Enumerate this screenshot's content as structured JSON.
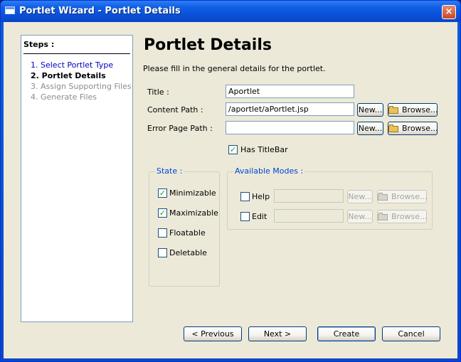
{
  "window": {
    "title": "Portlet Wizard - Portlet Details",
    "close_glyph": "×"
  },
  "steps": {
    "title": "Steps :",
    "items": [
      {
        "label": "1. Select Portlet Type",
        "state": "done"
      },
      {
        "label": "2. Portlet Details",
        "state": "current"
      },
      {
        "label": "3. Assign Supporting Files",
        "state": "future"
      },
      {
        "label": "4. Generate Files",
        "state": "future"
      }
    ]
  },
  "main": {
    "heading": "Portlet Details",
    "description": "Please fill in the general details for the portlet."
  },
  "form": {
    "title_label": "Title :",
    "title_value": "Aportlet",
    "content_path_label": "Content Path :",
    "content_path_value": "/aportlet/aPortlet.jsp",
    "error_page_path_label": "Error Page Path :",
    "error_page_path_value": "",
    "new_label": "New...",
    "browse_label": "Browse...",
    "has_titlebar_label": "Has TitleBar",
    "has_titlebar_checked": true,
    "check_glyph": "✓"
  },
  "state_group": {
    "title": "State :",
    "options": [
      {
        "label": "Minimizable",
        "checked": true
      },
      {
        "label": "Maximizable",
        "checked": true
      },
      {
        "label": "Floatable",
        "checked": false
      },
      {
        "label": "Deletable",
        "checked": false
      }
    ]
  },
  "modes_group": {
    "title": "Available Modes :",
    "modes": [
      {
        "label": "Help",
        "checked": false,
        "value": ""
      },
      {
        "label": "Edit",
        "checked": false,
        "value": ""
      }
    ]
  },
  "footer": {
    "previous": "< Previous",
    "next": "Next >",
    "create": "Create",
    "cancel": "Cancel"
  },
  "colors": {
    "titlebar": "#0a4fd6",
    "window_bg": "#ece9d8",
    "step_done": "#0000c0",
    "step_future": "#8c8c8c",
    "group_title": "#0046d5",
    "check": "#21a121"
  }
}
